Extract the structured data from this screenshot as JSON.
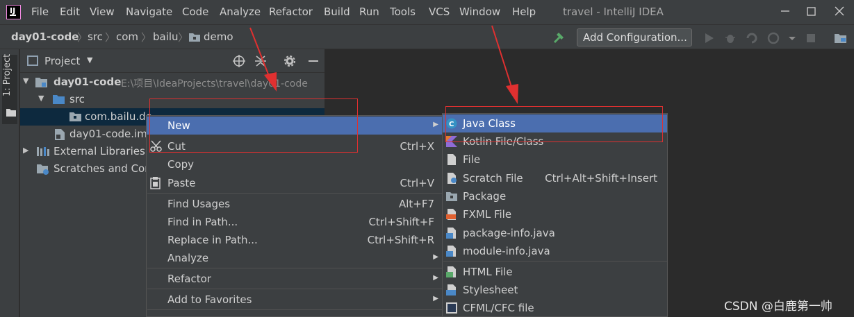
{
  "window": {
    "title": "travel - IntelliJ IDEA"
  },
  "menubar": {
    "items": [
      {
        "label": "File"
      },
      {
        "label": "Edit"
      },
      {
        "label": "View"
      },
      {
        "label": "Navigate"
      },
      {
        "label": "Code"
      },
      {
        "label": "Analyze"
      },
      {
        "label": "Refactor"
      },
      {
        "label": "Build"
      },
      {
        "label": "Run"
      },
      {
        "label": "Tools"
      },
      {
        "label": "VCS"
      },
      {
        "label": "Window"
      },
      {
        "label": "Help"
      }
    ]
  },
  "breadcrumb": [
    "day01-code",
    "src",
    "com",
    "bailu",
    "demo"
  ],
  "toolbar": {
    "add_configuration": "Add Configuration..."
  },
  "tool_strip": {
    "project_label": "1: Project"
  },
  "project_panel": {
    "title": "Project",
    "tree": [
      {
        "label": "day01-code",
        "path": "E:\\项目\\IdeaProjects\\travel\\day01-code"
      },
      {
        "label": "src"
      },
      {
        "label": "com.bailu.de"
      },
      {
        "label": "day01-code.im"
      },
      {
        "label": "External Libraries"
      },
      {
        "label": "Scratches and Con"
      }
    ]
  },
  "context_menu": {
    "items": [
      {
        "label": "New",
        "shortcut": "",
        "submenu": true,
        "selected": true
      },
      {
        "label": "Cut",
        "shortcut": "Ctrl+X"
      },
      {
        "label": "Copy",
        "shortcut": ""
      },
      {
        "label": "Paste",
        "shortcut": "Ctrl+V"
      },
      {
        "label": "Find Usages",
        "shortcut": "Alt+F7"
      },
      {
        "label": "Find in Path...",
        "shortcut": "Ctrl+Shift+F"
      },
      {
        "label": "Replace in Path...",
        "shortcut": "Ctrl+Shift+R"
      },
      {
        "label": "Analyze",
        "shortcut": "",
        "submenu": true
      },
      {
        "label": "Refactor",
        "shortcut": "",
        "submenu": true
      },
      {
        "label": "Add to Favorites",
        "shortcut": "",
        "submenu": true
      }
    ]
  },
  "sub_menu": {
    "items": [
      {
        "label": "Java Class",
        "shortcut": "",
        "icon": "java-class-icon",
        "selected": true
      },
      {
        "label": "Kotlin File/Class",
        "shortcut": "",
        "icon": "kotlin-icon"
      },
      {
        "label": "File",
        "shortcut": "",
        "icon": "file-icon"
      },
      {
        "label": "Scratch File",
        "shortcut": "Ctrl+Alt+Shift+Insert",
        "icon": "scratch-file-icon"
      },
      {
        "label": "Package",
        "shortcut": "",
        "icon": "package-icon"
      },
      {
        "label": "FXML File",
        "shortcut": "",
        "icon": "fxml-icon"
      },
      {
        "label": "package-info.java",
        "shortcut": "",
        "icon": "java-file-icon"
      },
      {
        "label": "module-info.java",
        "shortcut": "",
        "icon": "java-file-icon"
      },
      {
        "label": "HTML File",
        "shortcut": "",
        "icon": "html-icon"
      },
      {
        "label": "Stylesheet",
        "shortcut": "",
        "icon": "css-icon"
      },
      {
        "label": "CFML/CFC file",
        "shortcut": "",
        "icon": "cfml-icon"
      }
    ]
  },
  "watermark": "CSDN @白鹿第一帅",
  "colors": {
    "selection": "#4b6eaf",
    "annotation": "#e03030",
    "background": "#2b2b2b",
    "panel": "#3c3f41"
  }
}
